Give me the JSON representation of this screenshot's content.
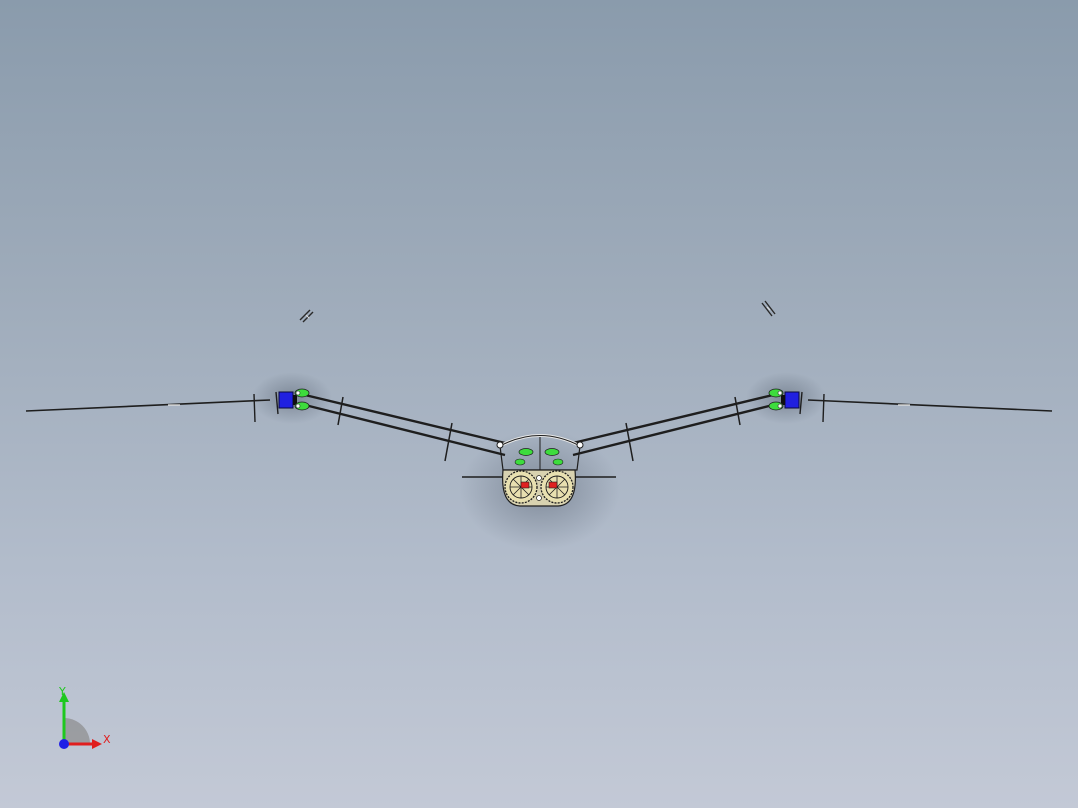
{
  "viewport": {
    "background_top": "#8a9bac",
    "background_bottom": "#c3c9d6"
  },
  "model": {
    "frame_color": "#1e1e1e",
    "motor_color": "#2020e0",
    "cam_color": "#3ddc3d",
    "gear_color": "#e8e0b0",
    "crank_color": "#e02020"
  },
  "triad": {
    "x_label": "X",
    "y_label": "Y",
    "x_color": "#e01e1e",
    "y_color": "#1ec81e",
    "z_color": "#1e1ee6"
  }
}
